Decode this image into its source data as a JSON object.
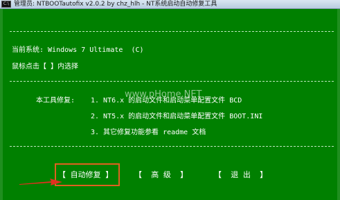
{
  "window": {
    "title": "管理员:  NTBOOTautofix v2.0.2 by chz_hlh - NT系统启动自动修复工具",
    "icon_text": "C:\\"
  },
  "status": {
    "current_system": "当前系统: Windows 7 Ultimate  (C)",
    "mouse_hint": "鼠标点击【 】内选择"
  },
  "repair_info": {
    "heading": "本工具修复:",
    "items": [
      "1. NT6.x 的启动文件和启动菜单配置文件 BCD",
      "2. NT5.x 的启动文件和启动菜单配置文件 BOOT.INI",
      "3. 其它修复功能参看 readme 文档"
    ]
  },
  "watermark": "www.pHome.NET",
  "menu": {
    "auto_repair": "【 自动修复 】",
    "advanced": "【  高 级  】",
    "exit": "【  退 出  】"
  },
  "colors": {
    "console_bg": "#008000",
    "highlight_border": "#e06020",
    "arrow": "#e03020"
  }
}
